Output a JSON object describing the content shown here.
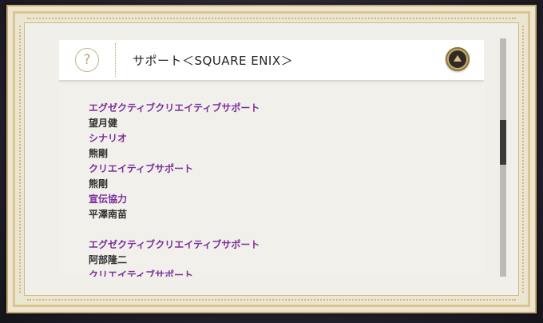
{
  "header": {
    "title": "サポート＜SQUARE ENIX＞",
    "help_icon_glyph": "?"
  },
  "credits": [
    {
      "type": "role",
      "text": "エグゼクティブクリエイティブサポート"
    },
    {
      "type": "name",
      "text": "望月健"
    },
    {
      "type": "role",
      "text": "シナリオ"
    },
    {
      "type": "name",
      "text": "熊剛"
    },
    {
      "type": "role",
      "text": "クリエイティブサポート"
    },
    {
      "type": "name",
      "text": "熊剛"
    },
    {
      "type": "role",
      "text": "宣伝協力"
    },
    {
      "type": "name",
      "text": "平澤南苗"
    },
    {
      "type": "spacer",
      "text": ""
    },
    {
      "type": "role",
      "text": "エグゼクティブクリエイティブサポート"
    },
    {
      "type": "name",
      "text": "阿部隆二"
    },
    {
      "type": "role",
      "text": "クリエイティブサポート"
    }
  ],
  "icons": {
    "help": "question-circle-icon",
    "collapse": "chevron-up-icon"
  },
  "colors": {
    "role_text": "#7a2e9e",
    "name_text": "#333333",
    "frame_gold": "#c5ad72",
    "panel_bg": "#f2f0ea"
  }
}
